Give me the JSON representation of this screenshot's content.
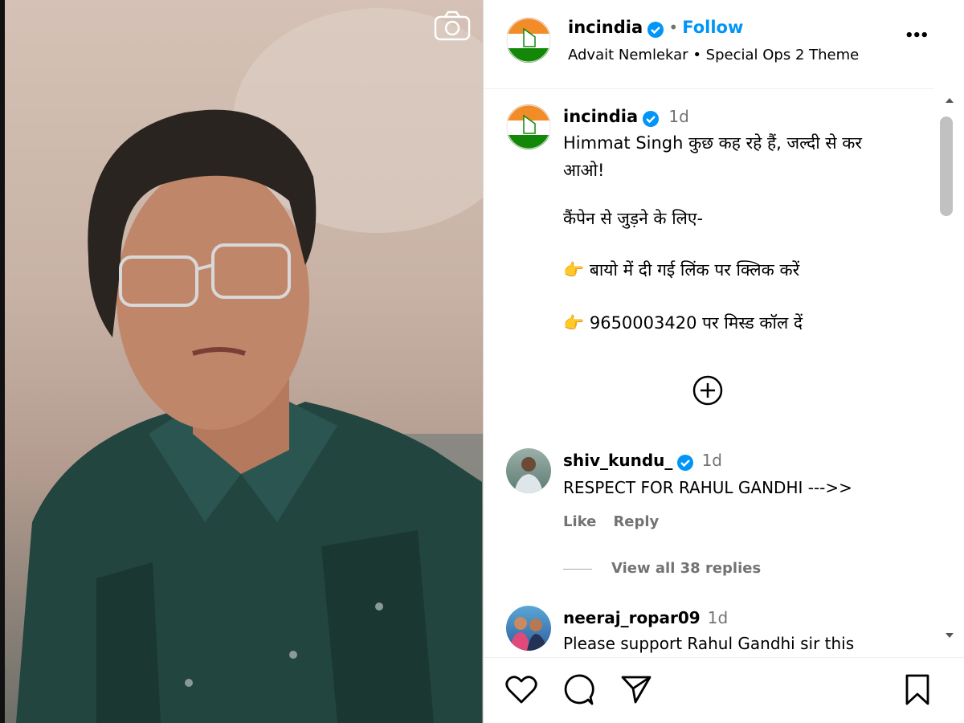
{
  "header": {
    "username": "incindia",
    "dot": "•",
    "follow_label": "Follow",
    "audio_artist": "Advait Nemlekar",
    "audio_sep": "•",
    "audio_title": "Special Ops 2 Theme",
    "more_label": "•••"
  },
  "caption": {
    "username": "incindia",
    "time": "1d",
    "line1": "Himmat Singh कुछ कह रहे हैं, जल्दी से कर",
    "line2": "आओ!",
    "line3": "कैंपेन से जुड़ने के लिए-",
    "bullet1_emoji": "👉",
    "bullet1_text": "बायो में दी गई लिंक पर क्लिक करें",
    "bullet2_emoji": "👉",
    "bullet2_text": "9650003420 पर मिस्ड कॉल दें"
  },
  "comments": [
    {
      "username": "shiv_kundu_",
      "time": "1d",
      "text": "RESPECT FOR RAHUL GANDHI --->>",
      "like_label": "Like",
      "reply_label": "Reply",
      "view_replies_label": "View all 38 replies"
    },
    {
      "username": "neeraj_ropar09",
      "time": "1d",
      "text": "Please support Rahul Gandhi sir this"
    }
  ],
  "icons": {
    "camera": "camera-icon",
    "verified": "verified-badge-icon",
    "add_comment": "plus-circle-icon",
    "like": "heart-icon",
    "comment": "comment-icon",
    "share": "send-icon",
    "save": "bookmark-icon"
  },
  "colors": {
    "accent_blue": "#0095f6",
    "verified_blue": "#0095f6",
    "saffron": "#f28c28",
    "green": "#138808"
  }
}
